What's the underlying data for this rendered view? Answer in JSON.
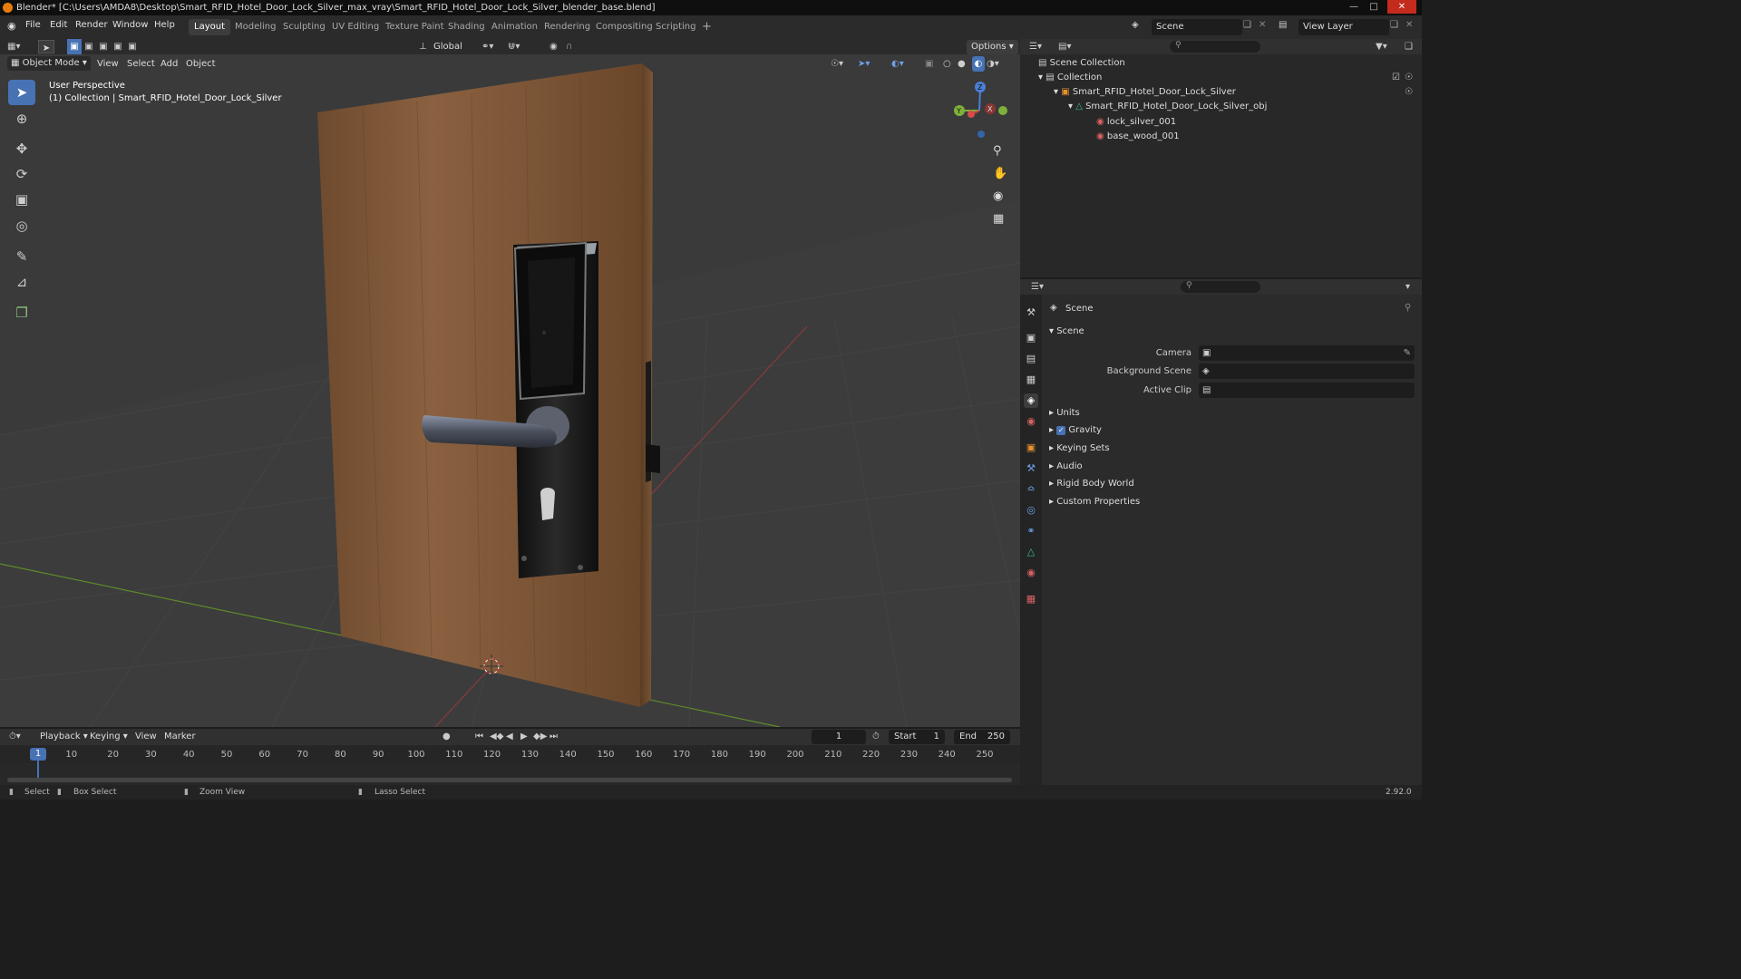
{
  "titlebar": {
    "title": "Blender* [C:\\Users\\AMDA8\\Desktop\\Smart_RFID_Hotel_Door_Lock_Silver_max_vray\\Smart_RFID_Hotel_Door_Lock_Silver_blender_base.blend]"
  },
  "menu": {
    "file": "File",
    "edit": "Edit",
    "render": "Render",
    "window": "Window",
    "help": "Help"
  },
  "workspaces": [
    "Layout",
    "Modeling",
    "Sculpting",
    "UV Editing",
    "Texture Paint",
    "Shading",
    "Animation",
    "Rendering",
    "Compositing",
    "Scripting"
  ],
  "scene_selector": "Scene",
  "view_layer": "View Layer",
  "viewport": {
    "mode": "Object Mode",
    "view": "View",
    "select": "Select",
    "add": "Add",
    "object": "Object",
    "orientation": "Global",
    "options": "Options",
    "perspective": "User Perspective",
    "collection_info": "(1) Collection | Smart_RFID_Hotel_Door_Lock_Silver",
    "gizmo": {
      "z": "Z",
      "y": "Y",
      "x": "X"
    }
  },
  "outliner": {
    "scene_collection": "Scene Collection",
    "collection": "Collection",
    "object": "Smart_RFID_Hotel_Door_Lock_Silver",
    "mesh": "Smart_RFID_Hotel_Door_Lock_Silver_obj",
    "mat1": "lock_silver_001",
    "mat2": "base_wood_001"
  },
  "properties": {
    "breadcrumb": "Scene",
    "panel": "Scene",
    "camera_label": "Camera",
    "bg_label": "Background Scene",
    "clip_label": "Active Clip",
    "sections": [
      "Units",
      "Gravity",
      "Keying Sets",
      "Audio",
      "Rigid Body World",
      "Custom Properties"
    ]
  },
  "timeline": {
    "playback": "Playback",
    "keying": "Keying",
    "view": "View",
    "marker": "Marker",
    "current": "1",
    "start_label": "Start",
    "start": "1",
    "end_label": "End",
    "end": "250",
    "ticks": [
      "1",
      "10",
      "20",
      "30",
      "40",
      "50",
      "60",
      "70",
      "80",
      "90",
      "100",
      "110",
      "120",
      "130",
      "140",
      "150",
      "160",
      "170",
      "180",
      "190",
      "200",
      "210",
      "220",
      "230",
      "240",
      "250"
    ]
  },
  "status": {
    "select": "Select",
    "box_select": "Box Select",
    "zoom_view": "Zoom View",
    "lasso": "Lasso Select",
    "version": "2.92.0"
  }
}
